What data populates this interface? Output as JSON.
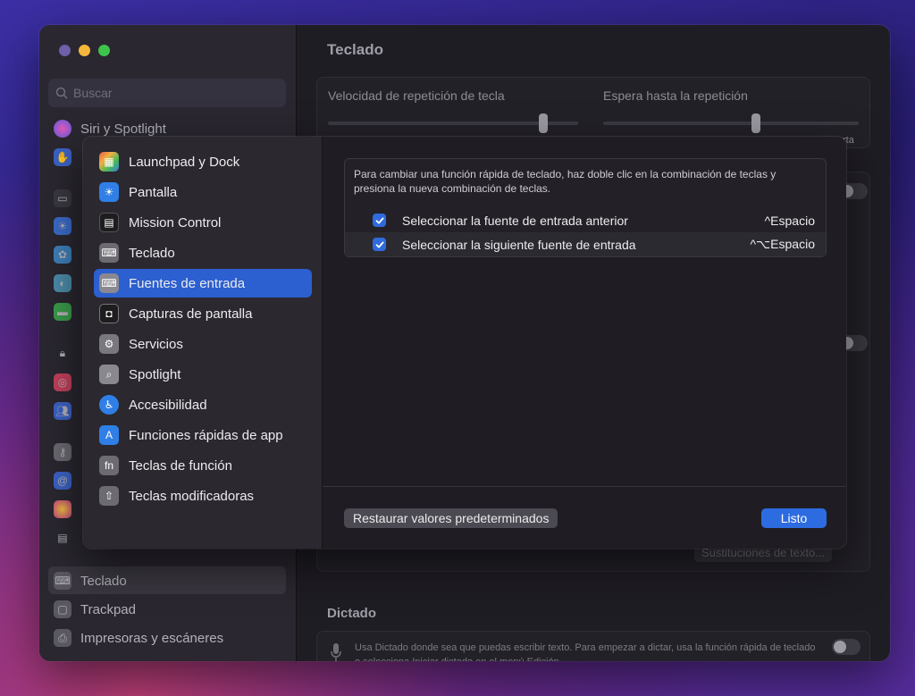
{
  "window": {
    "title": "Teclado",
    "search_placeholder": "Buscar"
  },
  "sidebar": {
    "items": [
      {
        "label": "Siri y Spotlight",
        "icon": "siri-icon"
      },
      {
        "label": "Teclado",
        "icon": "keyboard-icon",
        "selected": true
      },
      {
        "label": "Trackpad",
        "icon": "trackpad-icon"
      },
      {
        "label": "Impresoras y escáneres",
        "icon": "printer-icon"
      }
    ]
  },
  "keyboard_settings": {
    "repeat_speed_label": "Velocidad de repetición de tecla",
    "repeat_delay_label": "Espera hasta la repetición",
    "repeat_delay_suffix": "rta",
    "text_replacements_button": "Sustituciones de texto...",
    "dictation_title": "Dictado",
    "dictation_text": "Usa Dictado donde sea que puedas escribir texto. Para empezar a dictar, usa la función rápida de teclado o selecciona Iniciar dictado en el menú Edición."
  },
  "sheet": {
    "categories": [
      {
        "label": "Launchpad y Dock",
        "icon": "launchpad-icon",
        "color": "#e35b4a"
      },
      {
        "label": "Pantalla",
        "icon": "display-icon",
        "color": "#2f7fe6"
      },
      {
        "label": "Mission Control",
        "icon": "mission-control-icon",
        "color": "#1d1d1f"
      },
      {
        "label": "Teclado",
        "icon": "keyboard-icon",
        "color": "#6d6b72"
      },
      {
        "label": "Fuentes de entrada",
        "icon": "input-sources-icon",
        "color": "#6d6b72",
        "selected": true
      },
      {
        "label": "Capturas de pantalla",
        "icon": "screenshot-icon",
        "color": "#1d1d1f"
      },
      {
        "label": "Servicios",
        "icon": "services-gear-icon",
        "color": "#7a787f"
      },
      {
        "label": "Spotlight",
        "icon": "spotlight-icon",
        "color": "#8a888f"
      },
      {
        "label": "Accesibilidad",
        "icon": "accessibility-icon",
        "color": "#2f7fe6"
      },
      {
        "label": "Funciones rápidas de app",
        "icon": "app-store-icon",
        "color": "#2f7fe6"
      },
      {
        "label": "Teclas de función",
        "icon": "fn-key-icon",
        "color": "#6d6b72"
      },
      {
        "label": "Teclas modificadoras",
        "icon": "modifier-keys-icon",
        "color": "#6d6b72"
      }
    ],
    "info_text": "Para cambiar una función rápida de teclado, haz doble clic en la combinación de teclas y presiona la nueva combinación de teclas.",
    "shortcuts": [
      {
        "label": "Seleccionar la fuente de entrada anterior",
        "keys": "^Espacio",
        "checked": true
      },
      {
        "label": "Seleccionar la siguiente fuente de entrada",
        "keys": "^⌥Espacio",
        "checked": true
      }
    ],
    "restore_button": "Restaurar valores predeterminados",
    "done_button": "Listo"
  },
  "colors": {
    "accent": "#2d6be0",
    "selection": "#2c5fcf"
  }
}
